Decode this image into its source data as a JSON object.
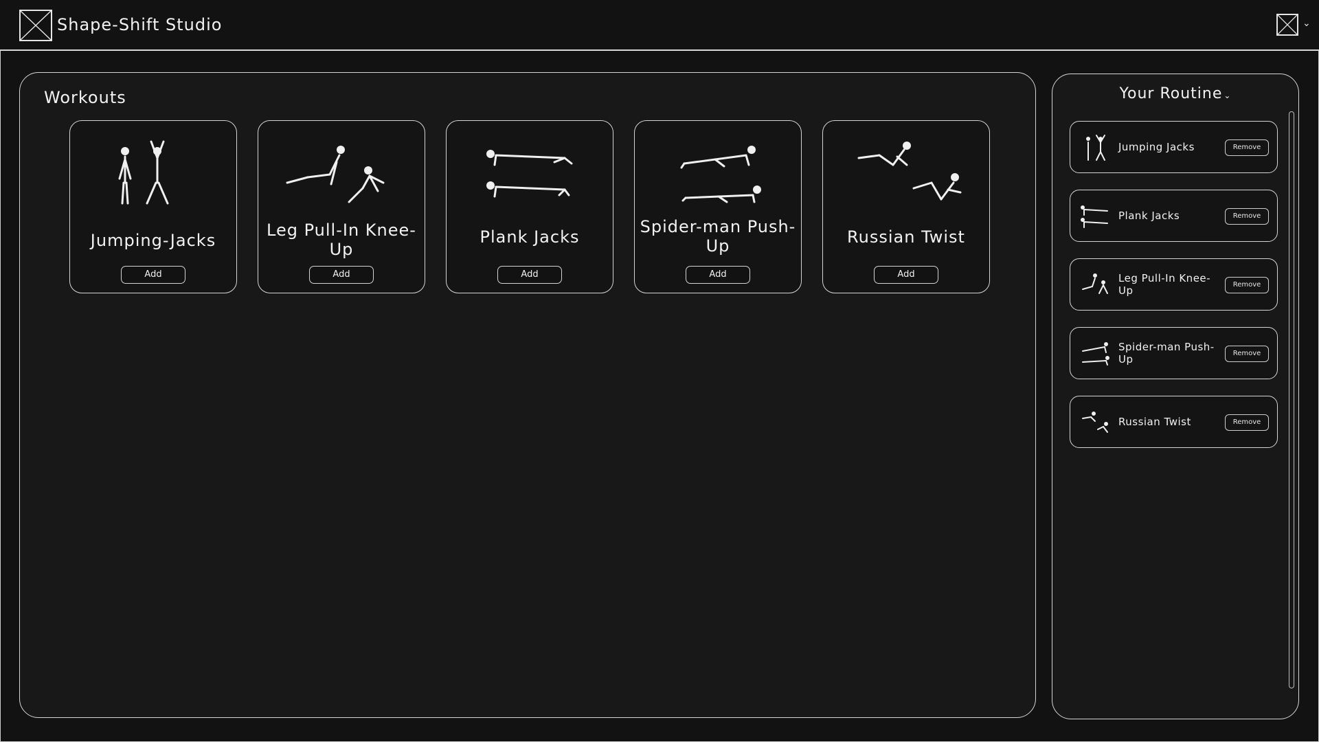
{
  "header": {
    "title": "Shape-Shift Studio"
  },
  "workouts": {
    "title": "Workouts",
    "cards": [
      {
        "name": "Jumping-Jacks",
        "add_label": "Add",
        "icon": "jumping-jacks-illustration"
      },
      {
        "name": "Leg Pull-In Knee-Up",
        "add_label": "Add",
        "icon": "leg-pull-in-illustration"
      },
      {
        "name": "Plank Jacks",
        "add_label": "Add",
        "icon": "plank-jacks-illustration"
      },
      {
        "name": "Spider-man Push-Up",
        "add_label": "Add",
        "icon": "spiderman-pushup-illustration"
      },
      {
        "name": "Russian Twist",
        "add_label": "Add",
        "icon": "russian-twist-illustration"
      }
    ]
  },
  "routine": {
    "title": "Your Routine",
    "items": [
      {
        "name": "Jumping Jacks",
        "remove_label": "Remove"
      },
      {
        "name": "Plank Jacks",
        "remove_label": "Remove"
      },
      {
        "name": "Leg Pull-In Knee-Up",
        "remove_label": "Remove"
      },
      {
        "name": "Spider-man Push-Up",
        "remove_label": "Remove"
      },
      {
        "name": "Russian Twist",
        "remove_label": "Remove"
      }
    ]
  },
  "colors": {
    "background": "#121212",
    "panel": "#181818",
    "border": "#d6d6d6",
    "text": "#f2f2f2"
  }
}
